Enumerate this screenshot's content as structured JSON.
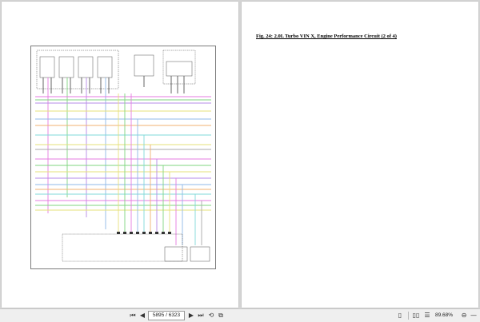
{
  "document": {
    "right_page_title": "Fig. 24: 2.0L Turbo VIN X, Engine Performance Circuit (2 of 4)"
  },
  "toolbar": {
    "page_indicator": "5895 / 6323",
    "zoom": "89.68%",
    "icons": [
      "first-page-icon",
      "prev-page-icon",
      "next-page-icon",
      "last-page-icon",
      "rotate-icon",
      "fit-page-icon",
      "single-page-view-icon",
      "two-page-view-icon",
      "continuous-view-icon",
      "zoom-out-icon",
      "zoom-in-icon"
    ]
  },
  "colors": {
    "wire_pink": "#e57be0",
    "wire_purple": "#b58be8",
    "wire_green": "#7fd67f",
    "wire_yellow": "#e6e07a",
    "wire_blue": "#8fb8e8",
    "wire_cyan": "#7fd9d9",
    "wire_orange": "#f0b070",
    "wire_gray": "#aaaaaa"
  }
}
